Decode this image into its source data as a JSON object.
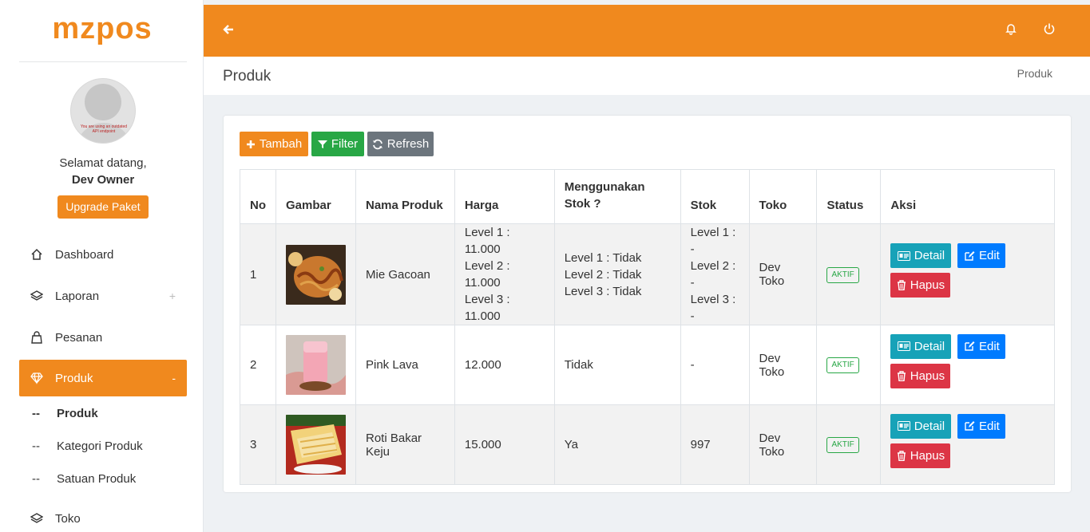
{
  "brand": {
    "logo_text": "mzpos",
    "accent": "#f0891e"
  },
  "sidebar": {
    "avatar_notice": "You are using an outdated API endpoint",
    "welcome": "Selamat datang,",
    "user_name": "Dev Owner",
    "upgrade_label": "Upgrade Paket",
    "items": [
      {
        "label": "Dashboard",
        "icon": "home-icon"
      },
      {
        "label": "Laporan",
        "icon": "layers-icon",
        "toggle": "+"
      },
      {
        "label": "Pesanan",
        "icon": "bag-icon"
      },
      {
        "label": "Produk",
        "icon": "diamond-icon",
        "toggle": "-"
      },
      {
        "label": "Toko",
        "icon": "layers-icon"
      }
    ],
    "sub_items": [
      {
        "dash": "--",
        "label": "Produk"
      },
      {
        "dash": "--",
        "label": "Kategori Produk"
      },
      {
        "dash": "--",
        "label": "Satuan Produk"
      }
    ]
  },
  "header": {
    "title": "Produk",
    "breadcrumb": "Produk"
  },
  "toolbar": {
    "add_label": "Tambah",
    "filter_label": "Filter",
    "refresh_label": "Refresh"
  },
  "table": {
    "columns": [
      "No",
      "Gambar",
      "Nama Produk",
      "Harga",
      "Menggunakan Stok ?",
      "Stok",
      "Toko",
      "Status",
      "Aksi"
    ],
    "rows": [
      {
        "no": "1",
        "name": "Mie Gacoan",
        "price": [
          "Level 1 : 11.000",
          "Level 2 : 11.000",
          "Level 3 : 11.000"
        ],
        "uses_stock": [
          "Level 1 : Tidak",
          "Level 2 : Tidak",
          "Level 3 : Tidak"
        ],
        "stock": [
          "Level 1 : -",
          "Level 2 : -",
          "Level 3 : -"
        ],
        "store": "Dev Toko",
        "status": "AKTIF"
      },
      {
        "no": "2",
        "name": "Pink Lava",
        "price": [
          "12.000"
        ],
        "uses_stock": [
          "Tidak"
        ],
        "stock": [
          "-"
        ],
        "store": "Dev Toko",
        "status": "AKTIF"
      },
      {
        "no": "3",
        "name": "Roti Bakar Keju",
        "price": [
          "15.000"
        ],
        "uses_stock": [
          "Ya"
        ],
        "stock": [
          "997"
        ],
        "store": "Dev Toko",
        "status": "AKTIF"
      }
    ],
    "actions": {
      "detail": "Detail",
      "edit": "Edit",
      "delete": "Hapus"
    }
  }
}
